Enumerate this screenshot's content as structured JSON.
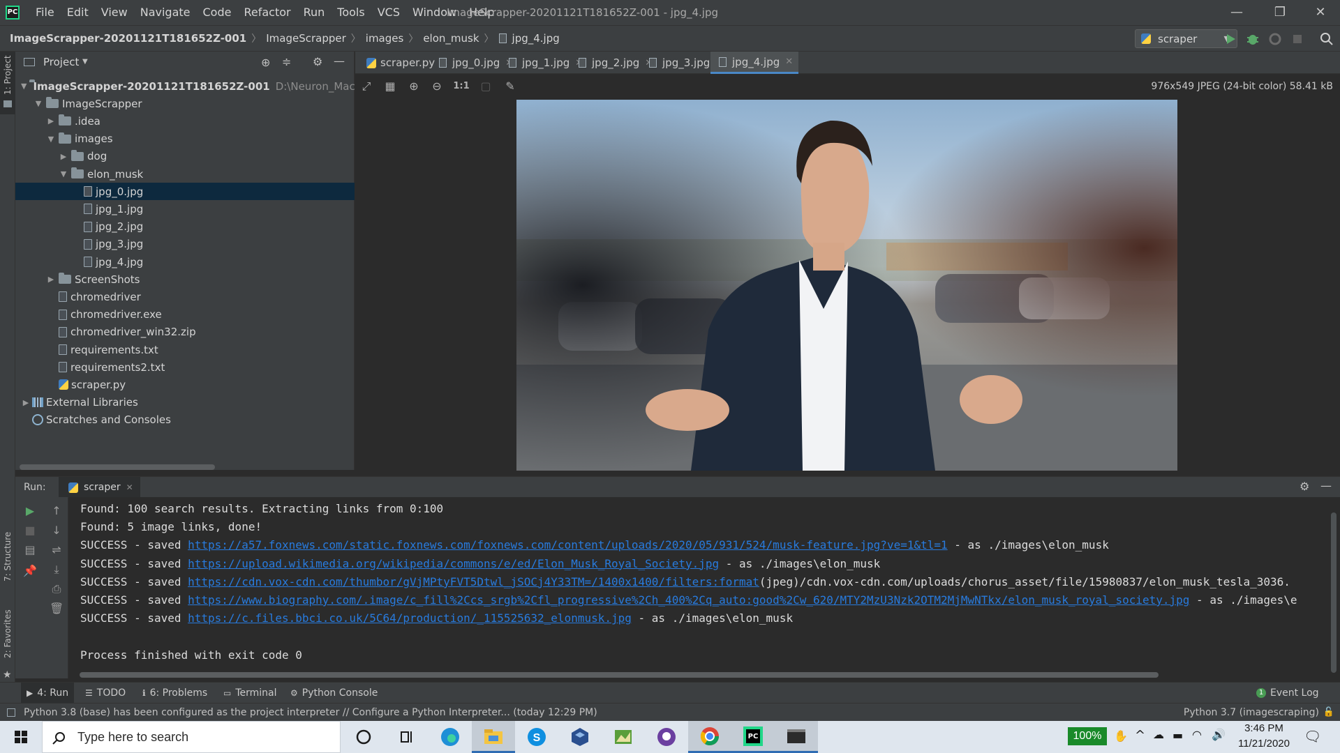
{
  "window": {
    "title": "ImageScrapper-20201121T181652Z-001 - jpg_4.jpg",
    "controls": [
      "—",
      "❐",
      "✕"
    ]
  },
  "menu": [
    "File",
    "Edit",
    "View",
    "Navigate",
    "Code",
    "Refactor",
    "Run",
    "Tools",
    "VCS",
    "Window",
    "Help"
  ],
  "breadcrumbs": [
    "ImageScrapper-20201121T181652Z-001",
    "ImageScrapper",
    "images",
    "elon_musk",
    "jpg_4.jpg"
  ],
  "run_config": "scraper",
  "left_strip": {
    "project_tab": "1: Project",
    "structure_tab": "7: Structure",
    "favorites_tab": "2: Favorites"
  },
  "project": {
    "header": "Project",
    "tree": [
      {
        "label": "ImageScrapper-20201121T181652Z-001",
        "path": "D:\\Neuron_Machine",
        "kind": "folder",
        "open": true,
        "depth": 0,
        "bold": true
      },
      {
        "label": "ImageScrapper",
        "kind": "folder",
        "open": true,
        "depth": 1
      },
      {
        "label": ".idea",
        "kind": "folder",
        "open": false,
        "depth": 2
      },
      {
        "label": "images",
        "kind": "folder",
        "open": true,
        "depth": 2
      },
      {
        "label": "dog",
        "kind": "folder",
        "open": false,
        "depth": 3
      },
      {
        "label": "elon_musk",
        "kind": "folder",
        "open": true,
        "depth": 3
      },
      {
        "label": "jpg_0.jpg",
        "kind": "file",
        "depth": 4,
        "selected": true
      },
      {
        "label": "jpg_1.jpg",
        "kind": "file",
        "depth": 4
      },
      {
        "label": "jpg_2.jpg",
        "kind": "file",
        "depth": 4
      },
      {
        "label": "jpg_3.jpg",
        "kind": "file",
        "depth": 4
      },
      {
        "label": "jpg_4.jpg",
        "kind": "file",
        "depth": 4
      },
      {
        "label": "ScreenShots",
        "kind": "folder",
        "open": false,
        "depth": 2
      },
      {
        "label": "chromedriver",
        "kind": "file",
        "depth": 2
      },
      {
        "label": "chromedriver.exe",
        "kind": "file",
        "depth": 2
      },
      {
        "label": "chromedriver_win32.zip",
        "kind": "file",
        "depth": 2
      },
      {
        "label": "requirements.txt",
        "kind": "file",
        "depth": 2
      },
      {
        "label": "requirements2.txt",
        "kind": "file",
        "depth": 2
      },
      {
        "label": "scraper.py",
        "kind": "py",
        "depth": 2
      },
      {
        "label": "External Libraries",
        "kind": "lib",
        "open": false,
        "depth": 0
      },
      {
        "label": "Scratches and Consoles",
        "kind": "scratch",
        "depth": 0
      }
    ]
  },
  "editor_tabs": [
    {
      "label": "scraper.py",
      "kind": "py"
    },
    {
      "label": "jpg_0.jpg",
      "kind": "file"
    },
    {
      "label": "jpg_1.jpg",
      "kind": "file"
    },
    {
      "label": "jpg_2.jpg",
      "kind": "file"
    },
    {
      "label": "jpg_3.jpg",
      "kind": "file"
    },
    {
      "label": "jpg_4.jpg",
      "kind": "file",
      "active": true
    }
  ],
  "image_info": "976x549 JPEG (24-bit color) 58.41 kB",
  "image_toolbar": {
    "actual_size": "1:1"
  },
  "run": {
    "label": "Run:",
    "tab": "scraper",
    "lines": [
      {
        "prefix": "Found: 100 search results. Extracting links from 0:100",
        "link": "",
        "suffix": ""
      },
      {
        "prefix": "Found: 5 image links, done!",
        "link": "",
        "suffix": ""
      },
      {
        "prefix": "SUCCESS - saved ",
        "link": "https://a57.foxnews.com/static.foxnews.com/foxnews.com/content/uploads/2020/05/931/524/musk-feature.jpg?ve=1&tl=1",
        "suffix": " - as ./images\\elon_musk"
      },
      {
        "prefix": "SUCCESS - saved ",
        "link": "https://upload.wikimedia.org/wikipedia/commons/e/ed/Elon_Musk_Royal_Society.jpg",
        "suffix": " - as ./images\\elon_musk"
      },
      {
        "prefix": "SUCCESS - saved ",
        "link": "https://cdn.vox-cdn.com/thumbor/gVjMPtyFVT5Dtwl_jSOCj4Y33TM=/1400x1400/filters:format",
        "suffix": "(jpeg)/cdn.vox-cdn.com/uploads/chorus_asset/file/15980837/elon_musk_tesla_3036."
      },
      {
        "prefix": "SUCCESS - saved ",
        "link": "https://www.biography.com/.image/c_fill%2Ccs_srgb%2Cfl_progressive%2Ch_400%2Cq_auto:good%2Cw_620/MTY2MzU3Nzk2OTM2MjMwNTkx/elon_musk_royal_society.jpg",
        "suffix": " - as ./images\\e"
      },
      {
        "prefix": "SUCCESS - saved ",
        "link": "https://c.files.bbci.co.uk/5C64/production/_115525632_elonmusk.jpg",
        "suffix": " - as ./images\\elon_musk"
      },
      {
        "prefix": "",
        "link": "",
        "suffix": ""
      },
      {
        "prefix": "Process finished with exit code 0",
        "link": "",
        "suffix": ""
      }
    ]
  },
  "bottom_tabs": [
    {
      "label": "4: Run",
      "icon": "run-icon",
      "active": true
    },
    {
      "label": "TODO",
      "icon": "list-icon"
    },
    {
      "label": "6: Problems",
      "icon": "info-icon"
    },
    {
      "label": "Terminal",
      "icon": "terminal-icon"
    },
    {
      "label": "Python Console",
      "icon": "python-icon"
    }
  ],
  "event_log": {
    "label": "Event Log",
    "count": "1"
  },
  "status": {
    "message": "Python 3.8 (base) has been configured as the project interpreter // Configure a Python Interpreter... (today 12:29 PM)",
    "interpreter": "Python 3.7 (imagescraping)"
  },
  "taskbar": {
    "search_placeholder": "Type here to search",
    "battery": "100%",
    "time": "3:46 PM",
    "date": "11/21/2020"
  }
}
